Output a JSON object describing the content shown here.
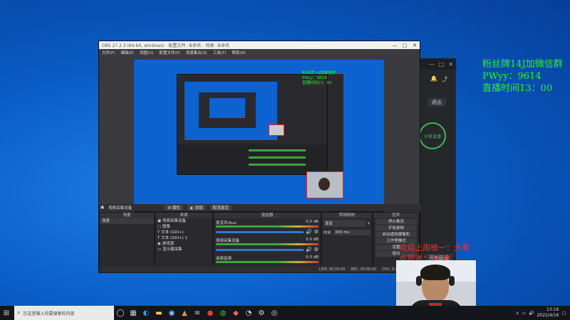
{
  "overlay": {
    "line1": "粉丝牌14J加微信群",
    "line2": "PWyy：9614",
    "line3": "直播时间13：00"
  },
  "obs": {
    "title": "OBS 27.2.3 (64-bit, windows) - 配置文件: 未命名 - 场景: 未命名",
    "menu": [
      "文件(F)",
      "编辑(E)",
      "视图(V)",
      "配置文件(P)",
      "场景集合(S)",
      "工具(T)",
      "帮助(H)"
    ],
    "source_bar": {
      "selected_source": "视频采集设备",
      "properties": "属性",
      "filters": "滤镜",
      "deactivate": "取消激活"
    },
    "docks": {
      "scenes": {
        "title": "场景",
        "items": [
          "场景"
        ]
      },
      "sources": {
        "title": "来源",
        "items": [
          "视频采集设备",
          "图像",
          "文本 (GDI+)",
          "文本 (GDI+) 1",
          "游戏源",
          "显示器采集"
        ]
      },
      "mixer": {
        "title": "混音器",
        "channels": [
          {
            "name": "麦克风/Aux",
            "db": "0.0 dB"
          },
          {
            "name": "视频采集设备",
            "db": "0.0 dB"
          },
          {
            "name": "桌面音频",
            "db": "0.0 dB"
          }
        ]
      },
      "transitions": {
        "title": "转场特效",
        "type": "渐变",
        "duration_label": "时长",
        "duration_value": "300 ms"
      },
      "controls": {
        "title": "控件",
        "buttons": [
          "停止推流",
          "开始录制",
          "启动虚拟摄像机",
          "工作室模式",
          "设置",
          "退出"
        ]
      }
    },
    "status": [
      "LIVE: 00:00:00",
      "REC: 00:00:00",
      "CPU: 0.4%, 60.00 fps"
    ]
  },
  "side_app": {
    "button": "退出",
    "circle_label": "分享直播",
    "bottom_button": "开始直播"
  },
  "comments": [
    "欢迎上周榜一：大青",
    "点赞送：7小木"
  ],
  "taskbar": {
    "search_placeholder": "在这里输入你要搜索的内容",
    "time": "13:16",
    "date": "2022/4/16"
  },
  "colors": {
    "overlay_green": "#2cf02c",
    "comment_red": "#f03030",
    "desktop_blue": "#0a5dc6"
  }
}
